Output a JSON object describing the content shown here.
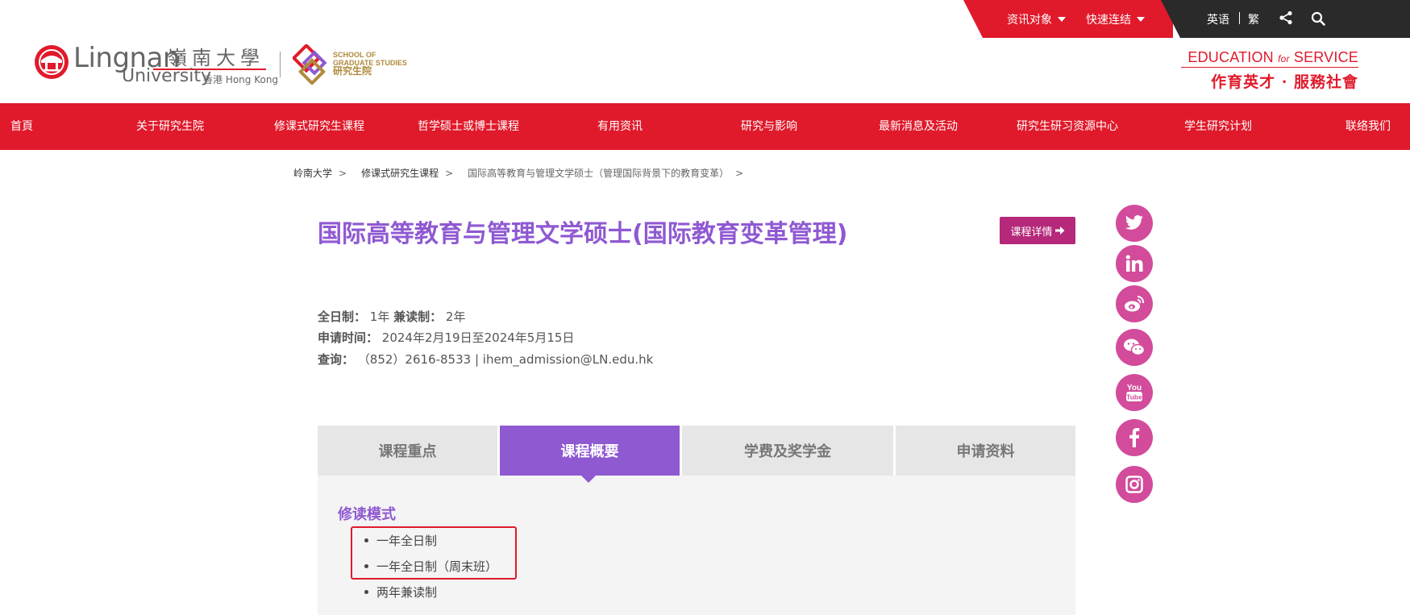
{
  "utility_bar": {
    "info_target_label": "资讯对象",
    "quick_links_label": "快速连结",
    "lang_en": "英语",
    "lang_trad": "繁"
  },
  "logos": {
    "lingnan_name": "Lingnan",
    "lingnan_zh": "嶺南大學",
    "lingnan_univ": "University",
    "lingnan_hk": "香港 Hong Kong",
    "sgs_line1": "SCHOOL OF",
    "sgs_line2": "GRADUATE STUDIES",
    "sgs_zh": "研究生院",
    "motto_en_1": "EDUCATION ",
    "motto_en_for": "for",
    "motto_en_2": " SERVICE",
    "motto_zh": "作育英才 · 服務社會"
  },
  "nav": {
    "items": [
      "首頁",
      "关于研究生院",
      "修课式研究生课程",
      "哲学硕士或博士课程",
      "有用资讯",
      "研究与影响",
      "最新消息及活动",
      "研究生研习资源中心",
      "学生研究计划",
      "联络我们"
    ]
  },
  "breadcrumb": {
    "items": [
      "岭南大学",
      "修课式研究生课程",
      "国际高等教育与管理文学硕士（管理国际背景下的教育变革）"
    ],
    "separator": ">"
  },
  "program": {
    "title": "国际高等教育与管理文学硕士(国际教育变革管理)",
    "detail_button": "课程详情",
    "duration_label": "全日制：",
    "duration_ft": "1年",
    "duration_pt_label": "兼读制：",
    "duration_pt": "2年",
    "application_label": "申请时间：",
    "application_period": "2024年2月19日至2024年5月15日",
    "enquiry_label": "查询：",
    "enquiry_value": "（852）2616-8533 | ihem_admission@LN.edu.hk"
  },
  "social": [
    "twitter-icon",
    "linkedin-icon",
    "weibo-icon",
    "wechat-icon",
    "youtube-icon",
    "facebook-icon",
    "instagram-icon"
  ],
  "tabs": {
    "items": [
      "课程重点",
      "课程概要",
      "学费及奖学金",
      "申请资料"
    ],
    "active_index": 1
  },
  "study_mode": {
    "title": "修读模式",
    "items": [
      "一年全日制",
      "一年全日制（周末班）",
      "两年兼读制"
    ]
  },
  "colors": {
    "brand_red": "#e01a2b",
    "purple": "#8f59d2",
    "magenta": "#b5287a",
    "social_pink": "#d34b9b"
  }
}
